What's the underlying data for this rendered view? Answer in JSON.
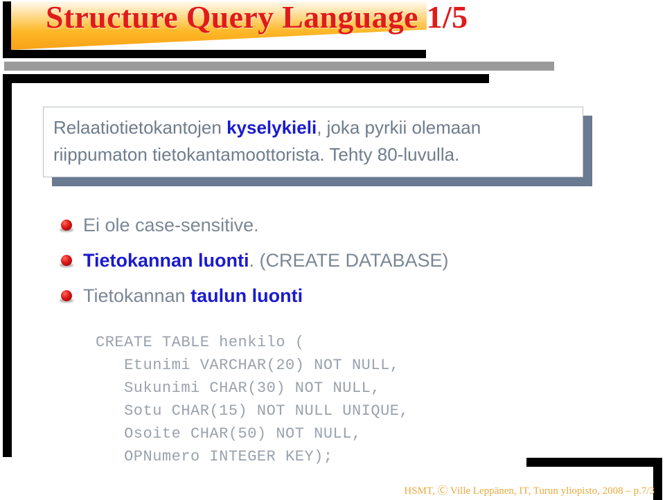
{
  "slide": {
    "title": "Structure Query Language 1/5",
    "title_color": "#e01b1b",
    "banner_color": "#f9a117"
  },
  "intro_box": {
    "line1_before": "Relaatiotietokantojen ",
    "line1_highlight": "kyselykieli",
    "line1_after": ", joka pyrkii olemaan",
    "line2": "riippumaton tietokantamoottorista. Tehty 80-luvulla.",
    "highlight_color": "#1a1ad0",
    "text_color": "#6f7c8c"
  },
  "bullets": [
    {
      "plain_before": "Ei ole case-sensitive.",
      "highlight": "",
      "plain_after": ""
    },
    {
      "plain_before": "",
      "highlight": "Tietokannan luonti",
      "plain_after": ". (CREATE DATABASE)"
    },
    {
      "plain_before": "Tietokannan ",
      "highlight": "taulun luonti",
      "plain_after": ""
    }
  ],
  "code": {
    "lines": [
      "CREATE TABLE henkilo (",
      "   Etunimi VARCHAR(20) NOT NULL,",
      "   Sukunimi CHAR(30) NOT NULL,",
      "   Sotu CHAR(15) NOT NULL UNIQUE,",
      "   Osoite CHAR(50) NOT NULL,",
      "   OPNumero INTEGER KEY);"
    ],
    "text_color": "#9aa2ad"
  },
  "footer": {
    "text": "HSMT, Ⓒ Ville Leppänen, IT, Turun yliopisto, 2008 – p.7/3",
    "color": "#e8a93c"
  }
}
